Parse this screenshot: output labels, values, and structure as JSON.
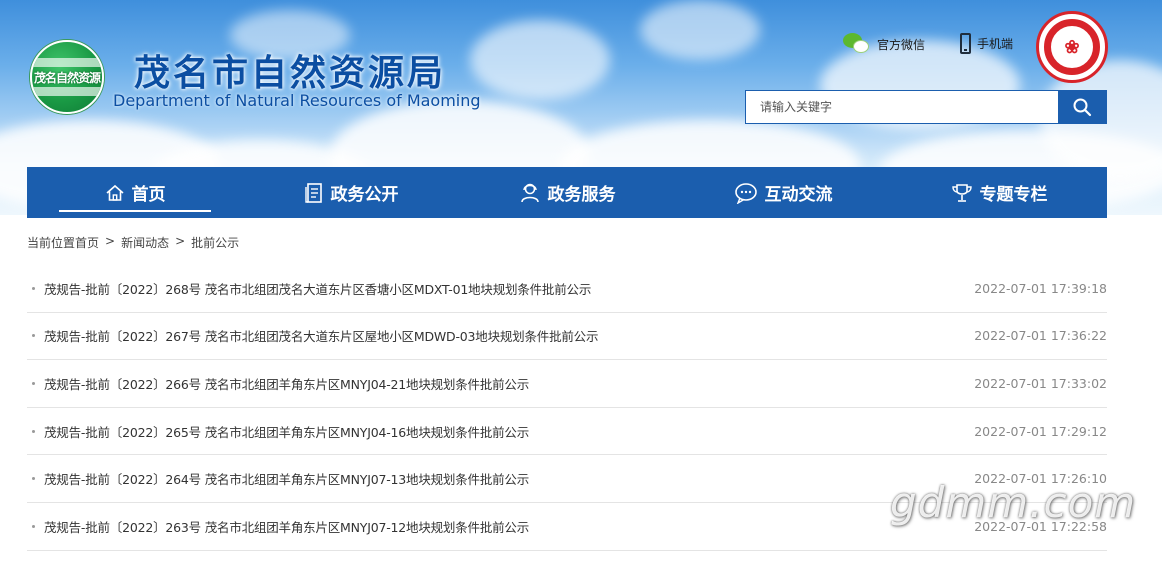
{
  "header": {
    "logo_seal_text": "茂名自然资源",
    "title": "茂名市自然资源局",
    "subtitle": "Department of Natural Resources of Maoming",
    "links": [
      {
        "label": "官方微信",
        "icon": "wechat-icon"
      },
      {
        "label": "手机端",
        "icon": "mobile-phone-icon"
      }
    ],
    "emblem_icon": "maoming-city-emblem"
  },
  "search": {
    "placeholder": "请输入关键字",
    "button_icon": "search-icon"
  },
  "nav": {
    "items": [
      {
        "label": "首页",
        "icon": "home-icon",
        "active": true
      },
      {
        "label": "政务公开",
        "icon": "document-icon",
        "active": false
      },
      {
        "label": "政务服务",
        "icon": "service-person-icon",
        "active": false
      },
      {
        "label": "互动交流",
        "icon": "chat-bubble-icon",
        "active": false
      },
      {
        "label": "专题专栏",
        "icon": "trophy-icon",
        "active": false
      }
    ]
  },
  "breadcrumb": {
    "prefix": "当前位置",
    "items": [
      "首页",
      "新闻动态",
      "批前公示"
    ],
    "separator": ">"
  },
  "list": {
    "items": [
      {
        "title": "茂规告-批前〔2022〕268号 茂名市北组团茂名大道东片区香塘小区MDXT-01地块规划条件批前公示",
        "date": "2022-07-01 17:39:18"
      },
      {
        "title": "茂规告-批前〔2022〕267号 茂名市北组团茂名大道东片区屋地小区MDWD-03地块规划条件批前公示",
        "date": "2022-07-01 17:36:22"
      },
      {
        "title": "茂规告-批前〔2022〕266号 茂名市北组团羊角东片区MNYJ04-21地块规划条件批前公示",
        "date": "2022-07-01 17:33:02"
      },
      {
        "title": "茂规告-批前〔2022〕265号 茂名市北组团羊角东片区MNYJ04-16地块规划条件批前公示",
        "date": "2022-07-01 17:29:12"
      },
      {
        "title": "茂规告-批前〔2022〕264号 茂名市北组团羊角东片区MNYJ07-13地块规划条件批前公示",
        "date": "2022-07-01 17:26:10"
      },
      {
        "title": "茂规告-批前〔2022〕263号 茂名市北组团羊角东片区MNYJ07-12地块规划条件批前公示",
        "date": "2022-07-01 17:22:58"
      }
    ]
  },
  "watermark": "gdmm.com",
  "colors": {
    "brand_blue": "#1b5eae",
    "title_blue": "#0b4ea2",
    "emblem_red": "#d8242a",
    "wechat_green": "#5cb82f"
  }
}
